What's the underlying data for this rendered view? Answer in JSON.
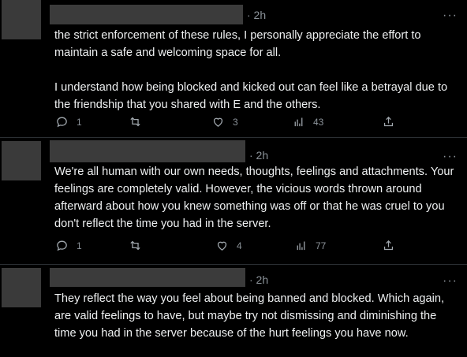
{
  "tweets": [
    {
      "time": "· 2h",
      "more": "···",
      "paragraphs": [
        "the strict enforcement of these rules, I personally appreciate the effort to maintain a safe and welcoming space for all.",
        "I understand how being blocked and kicked out can feel like a betrayal due to the friendship that you shared with E and the others."
      ],
      "replies": "1",
      "reposts": "",
      "likes": "3",
      "views": "43"
    },
    {
      "time": "· 2h",
      "more": "···",
      "paragraphs": [
        "We're all human with our own needs, thoughts, feelings and attachments. Your feelings are completely valid. However, the vicious words thrown around afterward about how you knew something was off or that he was cruel to you don't reflect the time you had in the server."
      ],
      "replies": "1",
      "reposts": "",
      "likes": "4",
      "views": "77"
    },
    {
      "time": "· 2h",
      "more": "···",
      "paragraphs": [
        "They reflect the way you feel about being banned and blocked. Which again, are valid feelings to have, but maybe try not dismissing and diminishing the time you had in the server because of the hurt feelings you have now."
      ]
    }
  ],
  "icons": {
    "reply": "speech-bubble",
    "repost": "retweet-arrows",
    "like": "heart",
    "views": "bar-chart",
    "share": "upload-arrow",
    "more": "ellipsis"
  },
  "colors": {
    "background": "#000000",
    "text": "#e7e9ea",
    "muted": "#8b9299",
    "redaction": "#3b3b3b"
  }
}
